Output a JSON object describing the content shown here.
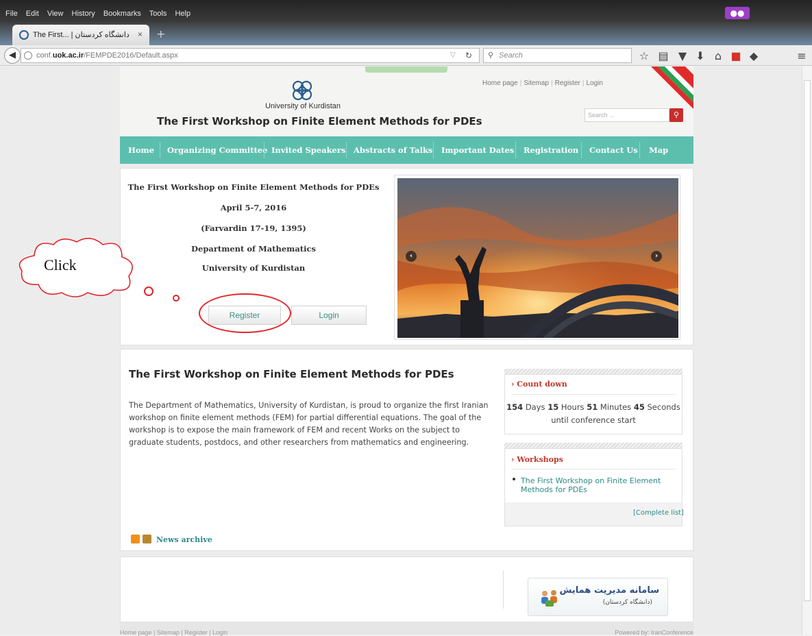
{
  "browser": {
    "menu": [
      "File",
      "Edit",
      "View",
      "History",
      "Bookmarks",
      "Tools",
      "Help"
    ],
    "tab_title": "The First... | دانشگاه کردستان",
    "tab_close": "×",
    "new_tab": "+",
    "url_prefix": "conf.",
    "url_domain": "uok.ac.ir",
    "url_path": "/FEMPDE2016/Default.aspx",
    "search_placeholder": "Search"
  },
  "header": {
    "links": [
      "Home page",
      "Sitemap",
      "Register",
      "Login"
    ],
    "university": "University of Kurdistan",
    "title": "The First Workshop on Finite Element Methods for PDEs",
    "search_placeholder": "Search ..."
  },
  "nav": [
    "Home",
    "Organizing Committee",
    "Invited Speakers",
    "Abstracts of Talks",
    "Important Dates",
    "Registration",
    "Contact Us",
    "Map"
  ],
  "hero": {
    "lines": [
      "The First Workshop on Finite Element Methods for PDEs",
      "April 5-7, 2016",
      "(Farvardin 17-19, 1395)",
      "Department of Mathematics",
      "University of Kurdistan"
    ],
    "register_button": "Register",
    "login_button": "Login"
  },
  "annotation": {
    "cloud_text": "Click"
  },
  "main": {
    "title": "The First Workshop on Finite Element Methods for PDEs",
    "paragraph": "The Department of Mathematics, University of Kurdistan, is proud to organize the first Iranian workshop on finite element methods (FEM) for partial differential equations. The goal of the workshop is to expose the main framework of FEM and recent Works on the subject to graduate students, postdocs, and other researchers from mathematics and engineering.",
    "news_archive": "News archive"
  },
  "countdown": {
    "heading": "Count down",
    "days": "154",
    "days_label": "Days",
    "hours": "15",
    "hours_label": "Hours",
    "minutes": "51",
    "minutes_label": "Minutes",
    "seconds": "45",
    "seconds_label": "Seconds",
    "until": "until conference start"
  },
  "workshops": {
    "heading": "Workshops",
    "item": "The First Workshop on Finite Element Methods for PDEs",
    "complete_list": "[Complete list]"
  },
  "footer": {
    "banner_title": "سامانه مدیریت همایش",
    "banner_sub": "(دانشگاه کردستان)",
    "bottom_left": "Home page | Sitemap | Register | Login",
    "bottom_right": "Powered by: IranConference"
  }
}
